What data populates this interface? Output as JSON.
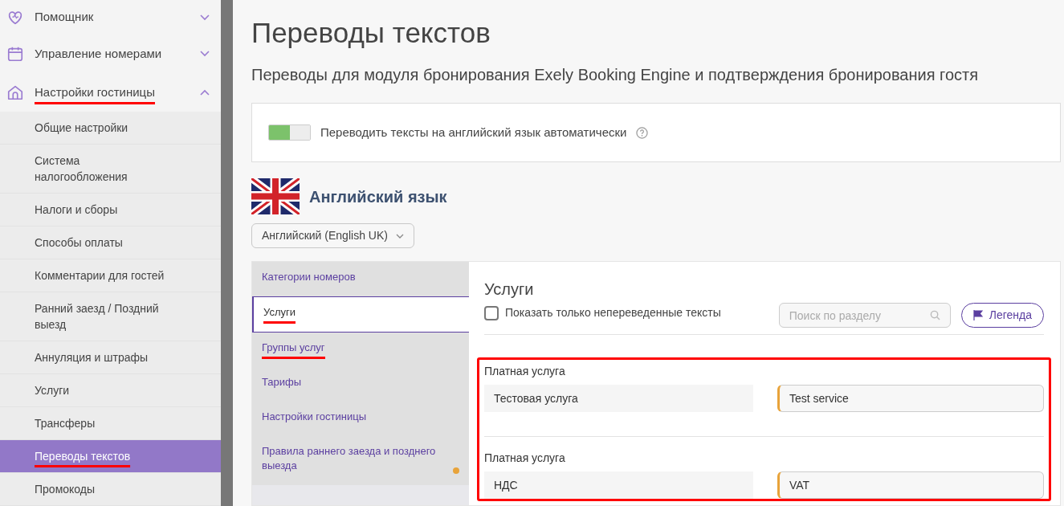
{
  "sidebar": {
    "groups": [
      {
        "label": "Помощник",
        "expanded": false,
        "underlined": false
      },
      {
        "label": "Управление номерами",
        "expanded": false,
        "underlined": false
      },
      {
        "label": "Настройки гостиницы",
        "expanded": true,
        "underlined": true,
        "children": [
          {
            "label": "Общие настройки",
            "selected": false,
            "underlined": false
          },
          {
            "label": "Система налогообложения",
            "selected": false,
            "underlined": false
          },
          {
            "label": "Налоги и сборы",
            "selected": false,
            "underlined": false
          },
          {
            "label": "Способы оплаты",
            "selected": false,
            "underlined": false
          },
          {
            "label": "Комментарии для гостей",
            "selected": false,
            "underlined": false
          },
          {
            "label": "Ранний заезд / Поздний выезд",
            "selected": false,
            "underlined": false
          },
          {
            "label": "Аннуляция и штрафы",
            "selected": false,
            "underlined": false
          },
          {
            "label": "Услуги",
            "selected": false,
            "underlined": false
          },
          {
            "label": "Трансферы",
            "selected": false,
            "underlined": false
          },
          {
            "label": "Переводы текстов",
            "selected": true,
            "underlined": true
          },
          {
            "label": "Промокоды",
            "selected": false,
            "underlined": false
          }
        ]
      }
    ]
  },
  "page": {
    "title": "Переводы текстов",
    "subtitle": "Переводы для модуля бронирования Exely Booking Engine и подтверждения бронирования гостя"
  },
  "auto_translate": {
    "on": true,
    "label": "Переводить тексты на английский язык автоматически"
  },
  "language": {
    "heading": "Английский язык",
    "dropdown": "Английский (English UK)"
  },
  "sections": [
    {
      "label": "Категории номеров",
      "selected": false,
      "underlined": false,
      "dot": false
    },
    {
      "label": "Услуги",
      "selected": true,
      "underlined": true,
      "dot": false
    },
    {
      "label": "Группы услуг",
      "selected": false,
      "underlined": true,
      "dot": false
    },
    {
      "label": "Тарифы",
      "selected": false,
      "underlined": false,
      "dot": false
    },
    {
      "label": "Настройки гостиницы",
      "selected": false,
      "underlined": false,
      "dot": false
    },
    {
      "label": "Правила раннего заезда и позднего выезда",
      "selected": false,
      "underlined": false,
      "dot": true
    }
  ],
  "section_panel": {
    "title": "Услуги",
    "only_untranslated": {
      "label": "Показать только непереведенные тексты",
      "checked": false
    },
    "search": {
      "placeholder": "Поиск по разделу"
    },
    "legend_button": "Легенда",
    "highlighted": true,
    "entries": [
      {
        "group": "Платная услуга",
        "source": "Тестовая услуга",
        "translation": "Test service"
      },
      {
        "group": "Платная услуга",
        "source": "НДС",
        "translation": "VAT"
      }
    ]
  }
}
